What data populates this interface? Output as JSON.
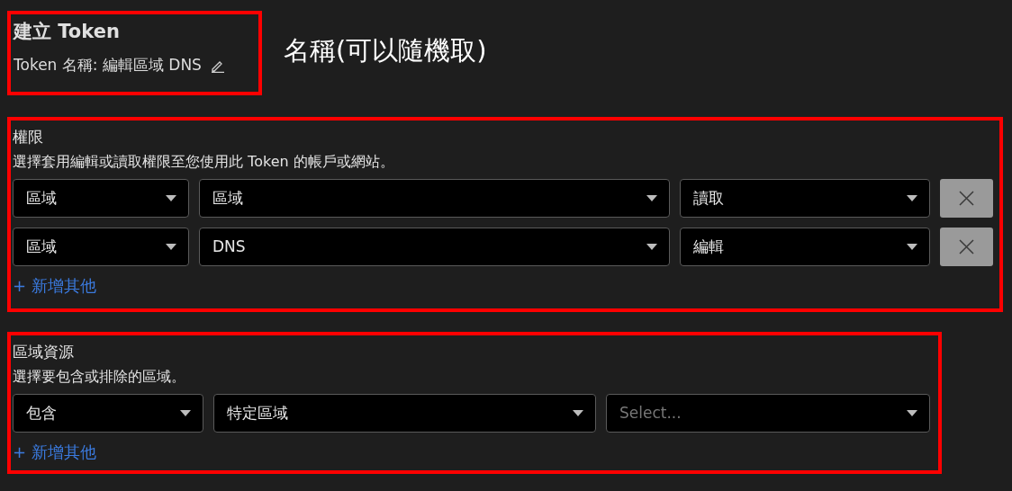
{
  "header": {
    "title": "建立 Token",
    "name_label": "Token 名稱: 編輯區域 DNS",
    "annotation": "名稱(可以隨機取)"
  },
  "permissions": {
    "title": "權限",
    "description": "選擇套用編輯或讀取權限至您使用此 Token 的帳戶或網站。",
    "rows": [
      {
        "scope": "區域",
        "resource": "區域",
        "access": "讀取"
      },
      {
        "scope": "區域",
        "resource": "DNS",
        "access": "編輯"
      }
    ],
    "add_label": "+ 新增其他"
  },
  "zone_resources": {
    "title": "區域資源",
    "description": "選擇要包含或排除的區域。",
    "filters": [
      {
        "value": "包含"
      },
      {
        "value": "特定區域"
      },
      {
        "placeholder": "Select..."
      }
    ],
    "add_label": "+ 新增其他"
  }
}
